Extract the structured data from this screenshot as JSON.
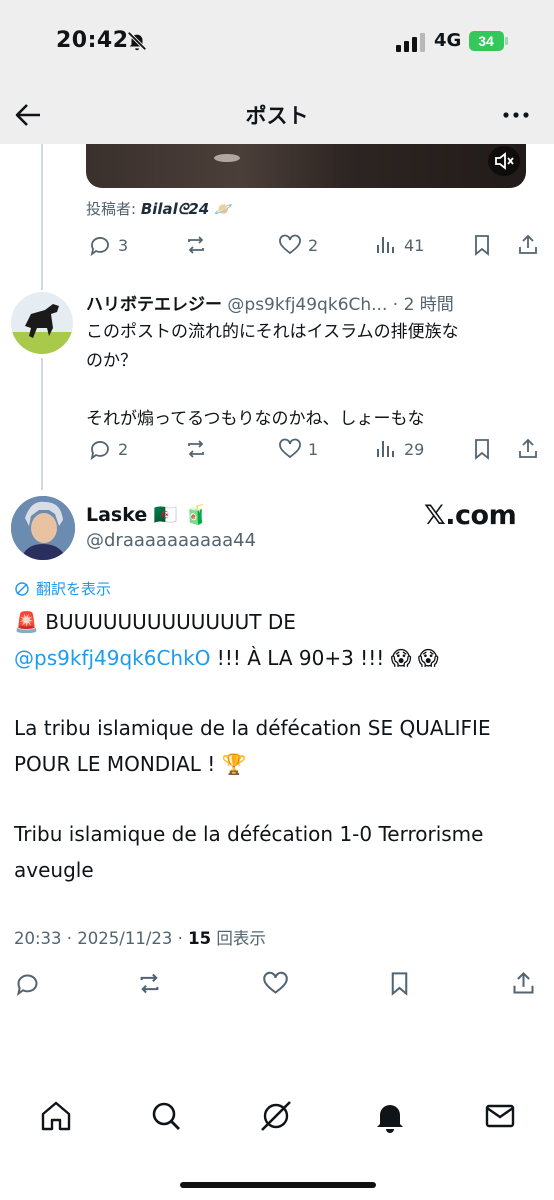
{
  "status_bar": {
    "time": "20:42",
    "network": "4G",
    "battery": "34"
  },
  "nav": {
    "title": "ポスト"
  },
  "prev_post": {
    "poster_label": "投稿者: ",
    "poster_name": "Bilal‌ᘓ24",
    "poster_emoji": "🪐",
    "stats": {
      "replies": "3",
      "reposts": "",
      "likes": "2",
      "views": "41"
    }
  },
  "reply": {
    "name": "ハリボテエレジー",
    "handle": "@ps9kfj49qk6Ch...",
    "time": "· 2 時間",
    "text_line1": "このポストの流れ的にそれはイスラムの排便族な",
    "text_line2": "のか？",
    "text_line3": "それが煽ってるつもりなのかね、しょーもな",
    "stats": {
      "replies": "2",
      "reposts": "",
      "likes": "1",
      "views": "29"
    }
  },
  "main_post": {
    "name": "Laske",
    "name_flags": "🇩🇿 🧃",
    "handle": "@draaaaaaaaaa44",
    "watermark": "𝕏.com",
    "translate_label": "翻訳を表示",
    "siren": "🚨",
    "line1": "BUUUUUUUUUUUUUT DE",
    "mention": "@ps9kfj49qk6ChkO",
    "line2_rest": " !!! À LA 90+3 !!! 😱 😱",
    "para2": "La tribu islamique de la défécation SE QUALIFIE POUR LE MONDIAL ! 🏆",
    "para3": "Tribu islamique de la défécation 1-0 Terrorisme aveugle",
    "timestamp": "20:33 · 2025/11/23 · ",
    "views_count": "15",
    "views_label": " 回表示"
  },
  "colors": {
    "accent": "#1d9bf0",
    "muted": "#536471",
    "text": "#0f1419",
    "battery": "#34c759"
  },
  "icons": [
    "back-arrow-icon",
    "more-icon",
    "mute-icon",
    "reply-icon",
    "repost-icon",
    "like-icon",
    "views-icon",
    "bookmark-icon",
    "share-icon",
    "translate-icon",
    "home-icon",
    "search-icon",
    "grok-icon",
    "notifications-icon",
    "messages-icon"
  ]
}
